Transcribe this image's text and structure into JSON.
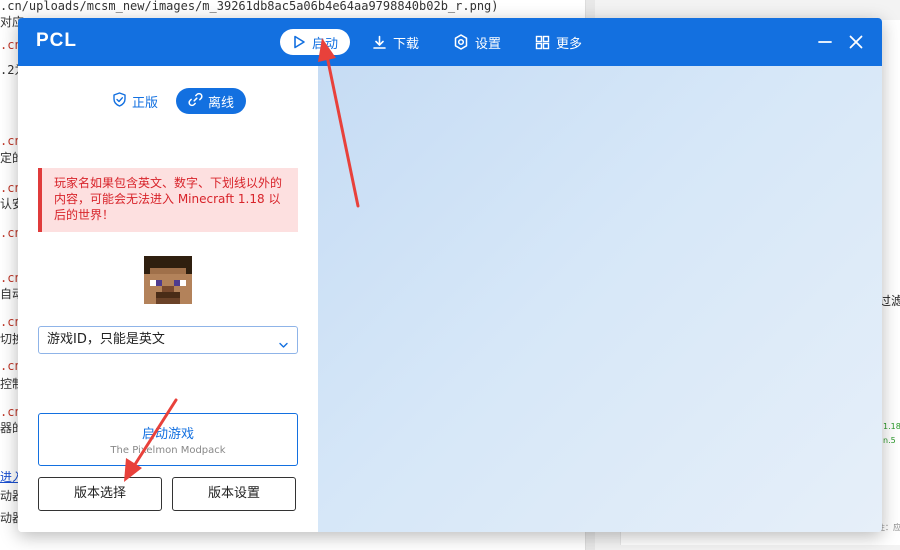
{
  "background": {
    "doc_lines": [
      {
        "text": ".cn/uploads/mcsm_new/images/m_39261db8ac5a06b4e64aa9798840b02b_r.png)",
        "kind": "plain"
      },
      {
        "text": "对应",
        "kind": "plain"
      },
      {
        "text": ".cn",
        "kind": "red"
      },
      {
        "text": ".2为",
        "kind": "plain"
      },
      {
        "text": ".cn",
        "kind": "red"
      },
      {
        "text": "定的",
        "kind": "plain"
      },
      {
        "text": ".cn",
        "kind": "red"
      },
      {
        "text": "认安",
        "kind": "plain"
      },
      {
        "text": ".cn",
        "kind": "red"
      },
      {
        "text": ".cn",
        "kind": "red"
      },
      {
        "text": "自动",
        "kind": "plain"
      },
      {
        "text": ".cn",
        "kind": "red"
      },
      {
        "text": "切换",
        "kind": "plain"
      },
      {
        "text": ".cn",
        "kind": "red"
      },
      {
        "text": "控制",
        "kind": "plain"
      },
      {
        "text": ".cn",
        "kind": "red"
      },
      {
        "text": "器的",
        "kind": "plain"
      },
      {
        "text": "进入",
        "kind": "blue"
      },
      {
        "text": "动器",
        "kind": "plain"
      },
      {
        "text": "动器",
        "kind": "plain"
      }
    ],
    "right_fragment": "过滤",
    "right_tiny": [
      "1.18",
      "n.5",
      "注：应用"
    ]
  },
  "window": {
    "app_title": "PCL",
    "nav": [
      {
        "label": "启动",
        "icon": "play-icon"
      },
      {
        "label": "下载",
        "icon": "download-icon"
      },
      {
        "label": "设置",
        "icon": "gear-icon"
      },
      {
        "label": "更多",
        "icon": "grid-icon"
      }
    ],
    "active_nav": "启动",
    "controls": {
      "minimize": "minimize-icon",
      "close": "close-icon"
    }
  },
  "launch": {
    "mode_official": "正版",
    "mode_offline": "离线",
    "active_mode": "离线",
    "warning": "玩家名如果包含英文、数字、下划线以外的内容，可能会无法进入 Minecraft 1.18 以后的世界！",
    "id_field": "游戏ID，只能是英文",
    "launch_button": "启动游戏",
    "launch_subtitle": "The Pixelmon Modpack",
    "version_select": "版本选择",
    "version_settings": "版本设置"
  },
  "colors": {
    "accent": "#1370e0",
    "warning_bg": "#fde0e0",
    "warning_text": "#d8232a",
    "arrow": "#e8413b"
  }
}
